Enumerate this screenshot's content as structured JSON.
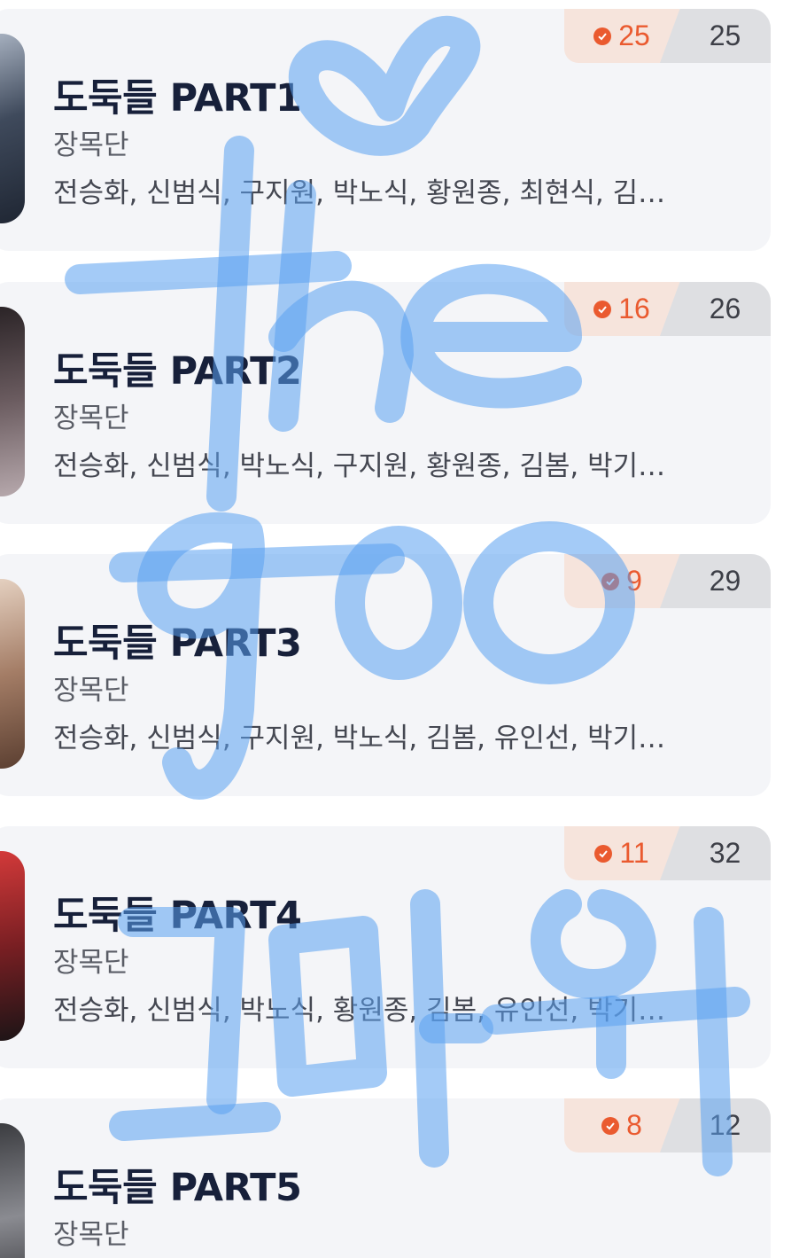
{
  "episodes": [
    {
      "title": "도둑들 PART1",
      "author": "장목단",
      "cast": "전승화, 신범식, 구지원, 박노식, 황원종, 최현식, 김…",
      "seen": "25",
      "total": "25",
      "thumb_colors": [
        "#a9b3c2",
        "#3f4a5c",
        "#1f2633"
      ]
    },
    {
      "title": "도둑들 PART2",
      "author": "장목단",
      "cast": "전승화, 신범식, 박노식, 구지원, 황원종, 김봄, 박기…",
      "seen": "16",
      "total": "26",
      "thumb_colors": [
        "#2a2326",
        "#6b5c60",
        "#b7a9ad"
      ]
    },
    {
      "title": "도둑들 PART3",
      "author": "장목단",
      "cast": "전승화, 신범식, 구지원, 박노식, 김봄, 유인선, 박기…",
      "seen": "9",
      "total": "29",
      "thumb_colors": [
        "#e6d2c2",
        "#a47d66",
        "#5b3f31"
      ]
    },
    {
      "title": "도둑들 PART4",
      "author": "장목단",
      "cast": "전승화, 신범식, 박노식, 황원종, 김봄, 유인선, 박기…",
      "seen": "11",
      "total": "32",
      "thumb_colors": [
        "#d43a3a",
        "#7a1f23",
        "#1c1416"
      ]
    },
    {
      "title": "도둑들 PART5",
      "author": "장목단",
      "cast": "",
      "seen": "8",
      "total": "12",
      "thumb_colors": [
        "#3a3b3f",
        "#8a8b91",
        "#2a2a2e"
      ]
    }
  ],
  "accent_color": "#ea5a2f",
  "overlay_color": "#5aa0f0",
  "icons": {
    "seen": "check-circle-icon"
  }
}
